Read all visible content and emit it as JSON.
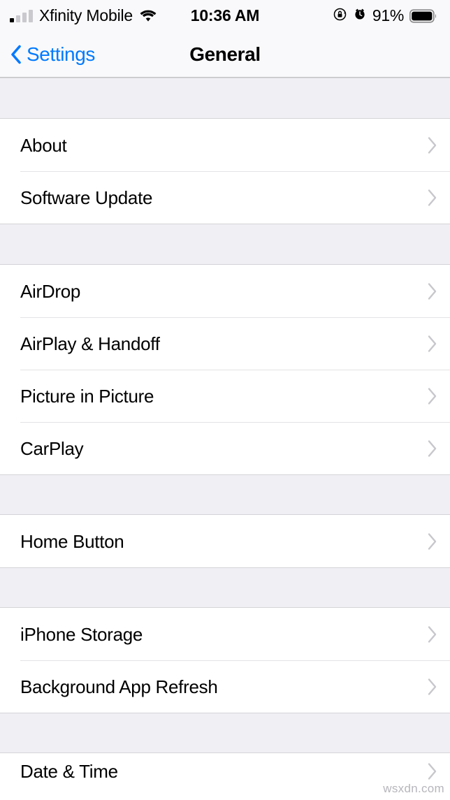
{
  "status_bar": {
    "carrier": "Xfinity Mobile",
    "signal_icon": "signal-bars-icon",
    "signal_bars_filled": 1,
    "signal_bars_total": 4,
    "wifi_icon": "wifi-icon",
    "time": "10:36 AM",
    "rotation_lock_icon": "rotation-lock-icon",
    "alarm_icon": "alarm-clock-icon",
    "battery_percent": "91%",
    "battery_icon": "battery-full-icon"
  },
  "nav_bar": {
    "back_icon": "chevron-left-icon",
    "back_label": "Settings",
    "title": "General"
  },
  "colors": {
    "accent_blue": "#007AFF",
    "group_background": "#EFEFF4",
    "row_background": "#FFFFFF",
    "separator": "#E3E3E6",
    "chevron": "#C7C7CC",
    "label_text": "#000000"
  },
  "sections": [
    {
      "id": "section-about",
      "rows": [
        {
          "label": "About",
          "accessory": "chevron-right-icon"
        },
        {
          "label": "Software Update",
          "accessory": "chevron-right-icon"
        }
      ]
    },
    {
      "id": "section-connectivity",
      "rows": [
        {
          "label": "AirDrop",
          "accessory": "chevron-right-icon"
        },
        {
          "label": "AirPlay & Handoff",
          "accessory": "chevron-right-icon"
        },
        {
          "label": "Picture in Picture",
          "accessory": "chevron-right-icon"
        },
        {
          "label": "CarPlay",
          "accessory": "chevron-right-icon"
        }
      ]
    },
    {
      "id": "section-home-button",
      "rows": [
        {
          "label": "Home Button",
          "accessory": "chevron-right-icon"
        }
      ]
    },
    {
      "id": "section-storage",
      "rows": [
        {
          "label": "iPhone Storage",
          "accessory": "chevron-right-icon"
        },
        {
          "label": "Background App Refresh",
          "accessory": "chevron-right-icon"
        }
      ]
    },
    {
      "id": "section-date-time",
      "rows": [
        {
          "label": "Date & Time",
          "accessory": "chevron-right-icon"
        }
      ]
    }
  ],
  "watermark": "wsxdn.com"
}
